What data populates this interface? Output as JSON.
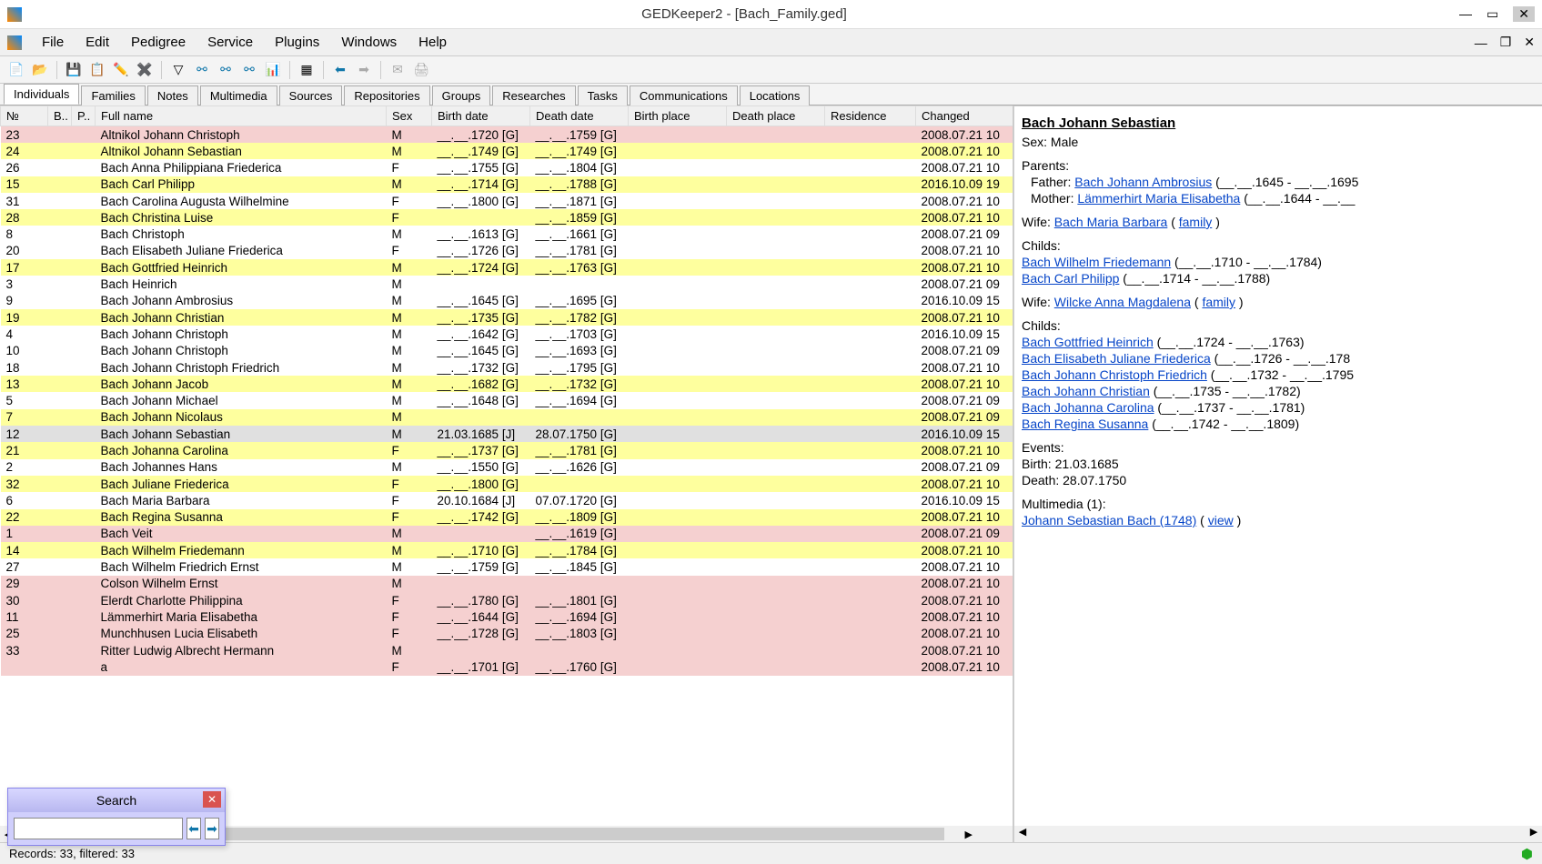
{
  "window": {
    "title": "GEDKeeper2 - [Bach_Family.ged]",
    "minimize": "—",
    "maximize": "▭",
    "close": "✕"
  },
  "mdi": {
    "min": "—",
    "restore": "❐",
    "close": "✕"
  },
  "menu": [
    "File",
    "Edit",
    "Pedigree",
    "Service",
    "Plugins",
    "Windows",
    "Help"
  ],
  "toolbar_icons": [
    "new-file",
    "open-file",
    "",
    "save",
    "edit-record",
    "edit-pencil",
    "delete-record",
    "",
    "filter",
    "tree-ancestors",
    "tree-descendants",
    "tree-both",
    "stats",
    "",
    "table-options",
    "",
    "nav-back",
    "nav-forward",
    "",
    "send-mail",
    "print"
  ],
  "tabs": [
    "Individuals",
    "Families",
    "Notes",
    "Multimedia",
    "Sources",
    "Repositories",
    "Groups",
    "Researches",
    "Tasks",
    "Communications",
    "Locations"
  ],
  "active_tab": 0,
  "columns": [
    "№",
    "B..",
    "P..",
    "Full name",
    "Sex",
    "Birth date",
    "Death date",
    "Birth place",
    "Death place",
    "Residence",
    "Changed"
  ],
  "rows": [
    {
      "c": "pink",
      "n": "23",
      "name": "Altnikol Johann Christoph",
      "sex": "M",
      "b": "__.__.1720 [G]",
      "d": "__.__.1759 [G]",
      "ch": "2008.07.21 10"
    },
    {
      "c": "yellow",
      "n": "24",
      "name": "Altnikol Johann Sebastian",
      "sex": "M",
      "b": "__.__.1749 [G]",
      "d": "__.__.1749 [G]",
      "ch": "2008.07.21 10"
    },
    {
      "c": "",
      "n": "26",
      "name": "Bach Anna Philippiana Friederica",
      "sex": "F",
      "b": "__.__.1755 [G]",
      "d": "__.__.1804 [G]",
      "ch": "2008.07.21 10"
    },
    {
      "c": "yellow",
      "n": "15",
      "name": "Bach Carl Philipp",
      "sex": "M",
      "b": "__.__.1714 [G]",
      "d": "__.__.1788 [G]",
      "ch": "2016.10.09 19"
    },
    {
      "c": "",
      "n": "31",
      "name": "Bach Carolina Augusta Wilhelmine",
      "sex": "F",
      "b": "__.__.1800 [G]",
      "d": "__.__.1871 [G]",
      "ch": "2008.07.21 10"
    },
    {
      "c": "yellow",
      "n": "28",
      "name": "Bach Christina Luise",
      "sex": "F",
      "b": "",
      "d": "__.__.1859 [G]",
      "ch": "2008.07.21 10"
    },
    {
      "c": "",
      "n": "8",
      "name": "Bach Christoph",
      "sex": "M",
      "b": "__.__.1613 [G]",
      "d": "__.__.1661 [G]",
      "ch": "2008.07.21 09"
    },
    {
      "c": "",
      "n": "20",
      "name": "Bach Elisabeth Juliane Friederica",
      "sex": "F",
      "b": "__.__.1726 [G]",
      "d": "__.__.1781 [G]",
      "ch": "2008.07.21 10"
    },
    {
      "c": "yellow",
      "n": "17",
      "name": "Bach Gottfried Heinrich",
      "sex": "M",
      "b": "__.__.1724 [G]",
      "d": "__.__.1763 [G]",
      "ch": "2008.07.21 10"
    },
    {
      "c": "",
      "n": "3",
      "name": "Bach Heinrich",
      "sex": "M",
      "b": "",
      "d": "",
      "ch": "2008.07.21 09"
    },
    {
      "c": "",
      "n": "9",
      "name": "Bach Johann Ambrosius",
      "sex": "M",
      "b": "__.__.1645 [G]",
      "d": "__.__.1695 [G]",
      "ch": "2016.10.09 15"
    },
    {
      "c": "yellow",
      "n": "19",
      "name": "Bach Johann Christian",
      "sex": "M",
      "b": "__.__.1735 [G]",
      "d": "__.__.1782 [G]",
      "ch": "2008.07.21 10"
    },
    {
      "c": "",
      "n": "4",
      "name": "Bach Johann Christoph",
      "sex": "M",
      "b": "__.__.1642 [G]",
      "d": "__.__.1703 [G]",
      "ch": "2016.10.09 15"
    },
    {
      "c": "",
      "n": "10",
      "name": "Bach Johann Christoph",
      "sex": "M",
      "b": "__.__.1645 [G]",
      "d": "__.__.1693 [G]",
      "ch": "2008.07.21 09"
    },
    {
      "c": "",
      "n": "18",
      "name": "Bach Johann Christoph Friedrich",
      "sex": "M",
      "b": "__.__.1732 [G]",
      "d": "__.__.1795 [G]",
      "ch": "2008.07.21 10"
    },
    {
      "c": "yellow",
      "n": "13",
      "name": "Bach Johann Jacob",
      "sex": "M",
      "b": "__.__.1682 [G]",
      "d": "__.__.1732 [G]",
      "ch": "2008.07.21 10"
    },
    {
      "c": "",
      "n": "5",
      "name": "Bach Johann Michael",
      "sex": "M",
      "b": "__.__.1648 [G]",
      "d": "__.__.1694 [G]",
      "ch": "2008.07.21 09"
    },
    {
      "c": "yellow",
      "n": "7",
      "name": "Bach Johann Nicolaus",
      "sex": "M",
      "b": "",
      "d": "",
      "ch": "2008.07.21 09"
    },
    {
      "c": "selected",
      "n": "12",
      "name": "Bach Johann Sebastian",
      "sex": "M",
      "b": "21.03.1685 [J]",
      "d": "28.07.1750 [G]",
      "ch": "2016.10.09 15"
    },
    {
      "c": "yellow",
      "n": "21",
      "name": "Bach Johanna Carolina",
      "sex": "F",
      "b": "__.__.1737 [G]",
      "d": "__.__.1781 [G]",
      "ch": "2008.07.21 10"
    },
    {
      "c": "",
      "n": "2",
      "name": "Bach Johannes Hans",
      "sex": "M",
      "b": "__.__.1550 [G]",
      "d": "__.__.1626 [G]",
      "ch": "2008.07.21 09"
    },
    {
      "c": "yellow",
      "n": "32",
      "name": "Bach Juliane Friederica",
      "sex": "F",
      "b": "__.__.1800 [G]",
      "d": "",
      "ch": "2008.07.21 10"
    },
    {
      "c": "",
      "n": "6",
      "name": "Bach Maria Barbara",
      "sex": "F",
      "b": "20.10.1684 [J]",
      "d": "07.07.1720 [G]",
      "ch": "2016.10.09 15"
    },
    {
      "c": "yellow",
      "n": "22",
      "name": "Bach Regina Susanna",
      "sex": "F",
      "b": "__.__.1742 [G]",
      "d": "__.__.1809 [G]",
      "ch": "2008.07.21 10"
    },
    {
      "c": "pink",
      "n": "1",
      "name": "Bach Veit",
      "sex": "M",
      "b": "",
      "d": "__.__.1619 [G]",
      "ch": "2008.07.21 09"
    },
    {
      "c": "yellow",
      "n": "14",
      "name": "Bach Wilhelm Friedemann",
      "sex": "M",
      "b": "__.__.1710 [G]",
      "d": "__.__.1784 [G]",
      "ch": "2008.07.21 10"
    },
    {
      "c": "",
      "n": "27",
      "name": "Bach Wilhelm Friedrich Ernst",
      "sex": "M",
      "b": "__.__.1759 [G]",
      "d": "__.__.1845 [G]",
      "ch": "2008.07.21 10"
    },
    {
      "c": "pink",
      "n": "29",
      "name": "Colson Wilhelm Ernst",
      "sex": "M",
      "b": "",
      "d": "",
      "ch": "2008.07.21 10"
    },
    {
      "c": "pink",
      "n": "30",
      "name": "Elerdt Charlotte Philippina",
      "sex": "F",
      "b": "__.__.1780 [G]",
      "d": "__.__.1801 [G]",
      "ch": "2008.07.21 10"
    },
    {
      "c": "pink",
      "n": "11",
      "name": "Lämmerhirt Maria Elisabetha",
      "sex": "F",
      "b": "__.__.1644 [G]",
      "d": "__.__.1694 [G]",
      "ch": "2008.07.21 10"
    },
    {
      "c": "pink",
      "n": "25",
      "name": "Munchhusen Lucia Elisabeth",
      "sex": "F",
      "b": "__.__.1728 [G]",
      "d": "__.__.1803 [G]",
      "ch": "2008.07.21 10"
    },
    {
      "c": "pink",
      "n": "33",
      "name": "Ritter Ludwig Albrecht Hermann",
      "sex": "M",
      "b": "",
      "d": "",
      "ch": "2008.07.21 10"
    },
    {
      "c": "pink",
      "n": "",
      "name": "a",
      "sex": "F",
      "b": "__.__.1701 [G]",
      "d": "__.__.1760 [G]",
      "ch": "2008.07.21 10"
    }
  ],
  "detail": {
    "name": "Bach Johann Sebastian",
    "sex_label": "Sex: Male",
    "parents_label": "Parents:",
    "father_label": "Father: ",
    "father": "Bach Johann Ambrosius",
    "father_dates": "  (__.__.1645 - __.__.1695",
    "mother_label": "Mother: ",
    "mother": "Lämmerhirt Maria Elisabetha",
    "mother_dates": "  (__.__.1644 - __.__",
    "wife1_label": "Wife: ",
    "wife1": "Bach Maria Barbara",
    "family_label": "family",
    "childs_label": "Childs:",
    "child1": "Bach Wilhelm Friedemann",
    "child1_d": "  (__.__.1710 - __.__.1784)",
    "child2": "Bach Carl Philipp",
    "child2_d": "  (__.__.1714 - __.__.1788)",
    "wife2_label": "Wife: ",
    "wife2": "Wilcke Anna Magdalena",
    "child3": "Bach Gottfried Heinrich",
    "child3_d": "  (__.__.1724 - __.__.1763)",
    "child4": "Bach Elisabeth Juliane Friederica",
    "child4_d": "  (__.__.1726 - __.__.178",
    "child5": "Bach Johann Christoph Friedrich",
    "child5_d": "  (__.__.1732 - __.__.1795",
    "child6": "Bach Johann Christian",
    "child6_d": "  (__.__.1735 - __.__.1782)",
    "child7": "Bach Johanna Carolina",
    "child7_d": "  (__.__.1737 - __.__.1781)",
    "child8": "Bach Regina Susanna",
    "child8_d": "  (__.__.1742 - __.__.1809)",
    "events_label": "Events:",
    "birth_ev": "Birth: 21.03.1685",
    "death_ev": "Death: 28.07.1750",
    "mm_label": "Multimedia (1):",
    "mm1": "Johann Sebastian Bach (1748)",
    "view_label": "view"
  },
  "status": {
    "records": "Records: 33, filtered: 33"
  },
  "search": {
    "title": "Search",
    "value": "",
    "prev": "⬅",
    "next": "➡"
  }
}
